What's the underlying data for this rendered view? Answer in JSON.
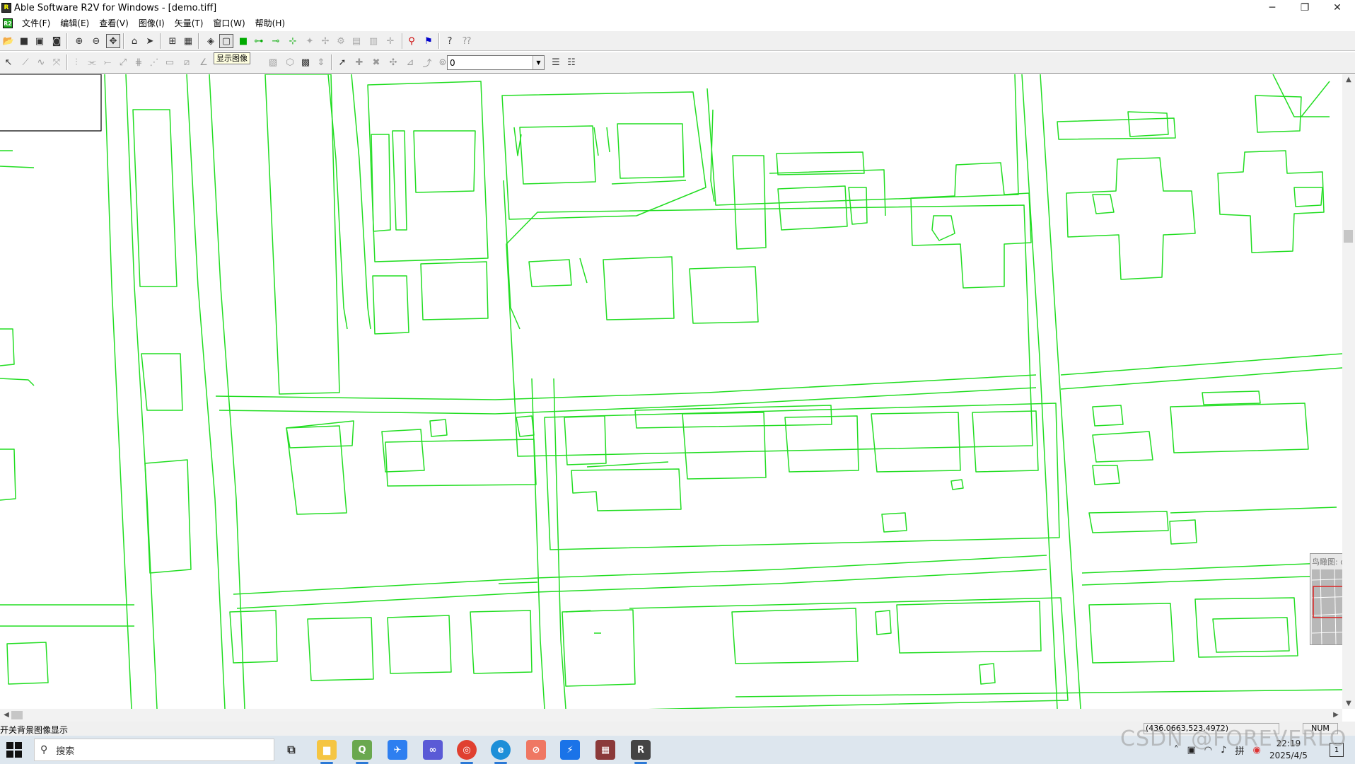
{
  "window": {
    "title": "Able Software R2V for Windows - [demo.tiff]",
    "minimize_glyph": "─",
    "restore_glyph": "❐",
    "close_glyph": "✕"
  },
  "menu": {
    "items": [
      "文件(F)",
      "编辑(E)",
      "查看(V)",
      "图像(I)",
      "矢量(T)",
      "窗口(W)",
      "帮助(H)"
    ]
  },
  "toolbar": {
    "tooltip": "显示图像",
    "layer_value": "0"
  },
  "colors": {
    "vector_line": "#22dd22",
    "accent": "#2b79d6"
  },
  "overview": {
    "title": "鸟瞰图: demo.tiff"
  },
  "status": {
    "message": "开关背景图像显示",
    "coords": "(436.0663,523.4972)",
    "num": "NUM"
  },
  "taskbar": {
    "search_placeholder": "搜索",
    "time": "22:19",
    "date": "2025/4/5",
    "notification_count": "1",
    "apps": [
      "task-view",
      "file-explorer",
      "qgis",
      "feishu",
      "baidu-netdisk",
      "chrome",
      "edge",
      "todo",
      "lark",
      "winrar",
      "r2v"
    ]
  },
  "watermark": "CSDN @FOREVERLO"
}
